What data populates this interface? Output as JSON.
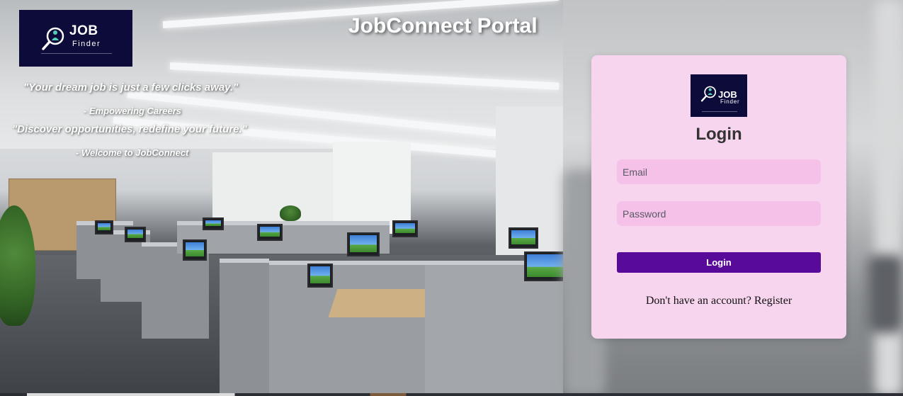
{
  "header": {
    "logo_word": "JOB",
    "logo_sub": "Finder",
    "portal_title": "JobConnect Portal"
  },
  "quotes": [
    {
      "text": "\"Your dream job is just a few clicks away.\"",
      "attribution": "- Empowering Careers"
    },
    {
      "text": "\"Discover opportunities, redefine your future.\"",
      "attribution": "- Welcome to JobConnect"
    }
  ],
  "login": {
    "logo_word": "JOB",
    "logo_sub": "Finder",
    "heading": "Login",
    "email_placeholder": "Email",
    "email_value": "",
    "password_placeholder": "Password",
    "password_value": "",
    "button_label": "Login",
    "register_prompt": "Don't have an account? ",
    "register_link": "Register"
  },
  "colors": {
    "logo_background": "#0c0b3a",
    "card_background": "#f8d5ee",
    "input_background": "#f6c1e8",
    "button_background": "#580b98",
    "logo_accent": "#4fd1b5"
  },
  "icons": {
    "logo_icon": "magnifier-person-icon"
  }
}
